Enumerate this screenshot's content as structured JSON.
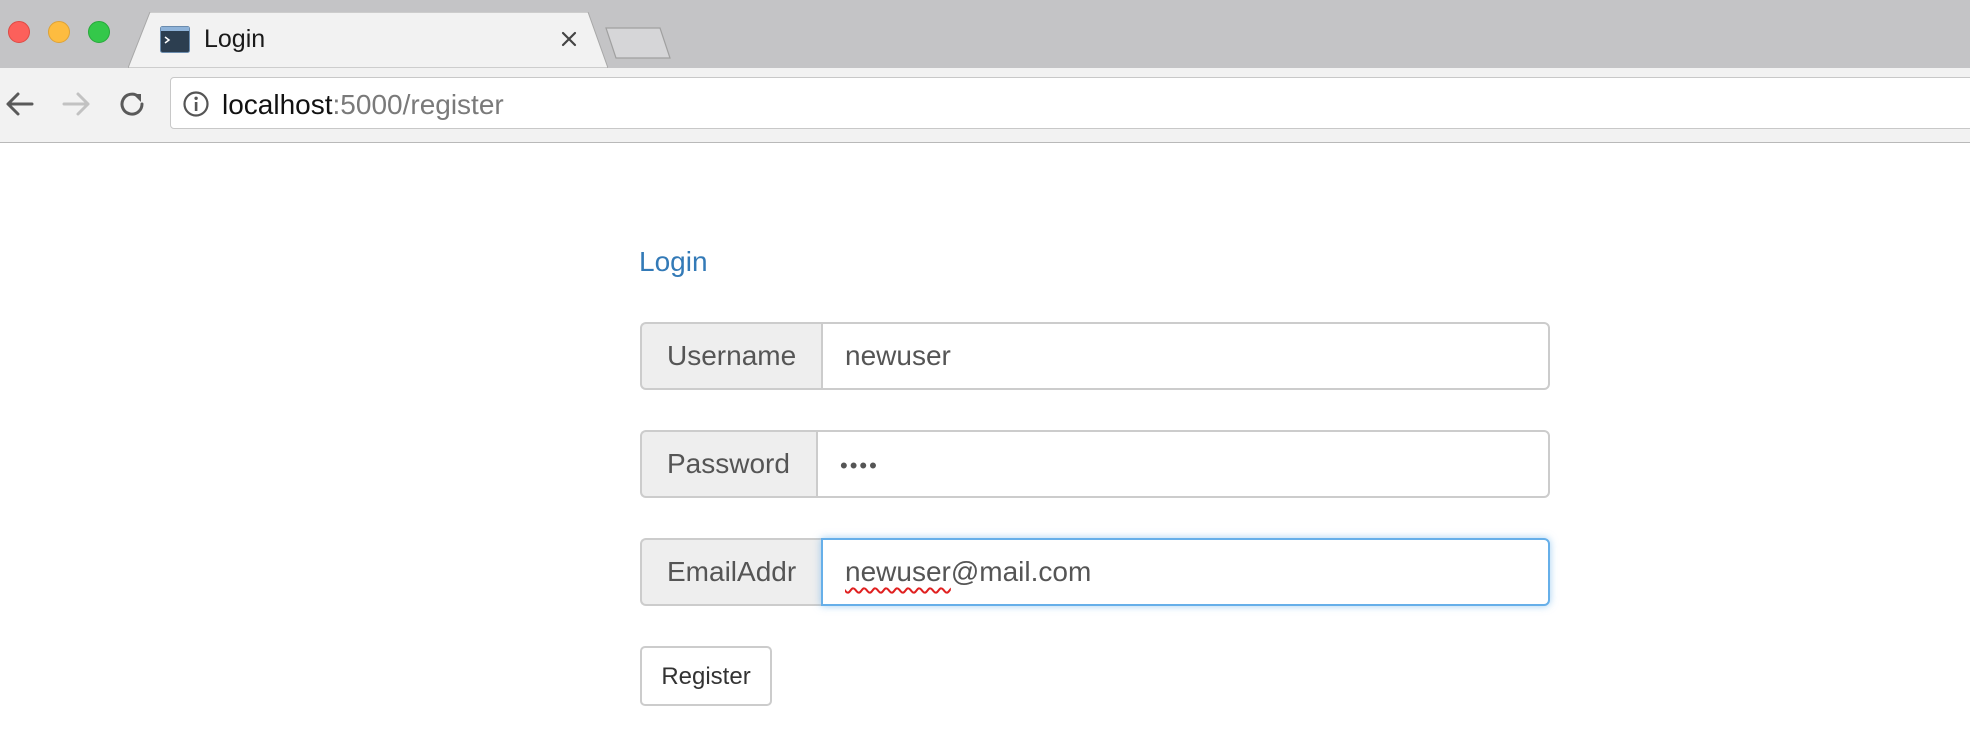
{
  "browser": {
    "tab": {
      "title": "Login",
      "favicon": "terminal-icon"
    },
    "url": {
      "host": "localhost",
      "rest": ":5000/register"
    },
    "icons": {
      "back": "back-arrow-icon",
      "forward": "forward-arrow-icon",
      "reload": "reload-icon",
      "info": "info-icon",
      "close": "close-icon"
    }
  },
  "page": {
    "login_link": "Login",
    "fields": [
      {
        "label": "Username",
        "value": "newuser"
      },
      {
        "label": "Password",
        "value": "••••"
      },
      {
        "label": "EmailAddr",
        "value_spelled": "newuser",
        "value_rest": "@mail.com"
      }
    ],
    "register_label": "Register"
  },
  "colors": {
    "link": "#337ab7",
    "focus_border": "#66afe9",
    "addon_bg": "#eeeeee",
    "tabbar_bg": "#c4c4c6",
    "toolbar_bg": "#f2f2f2"
  }
}
